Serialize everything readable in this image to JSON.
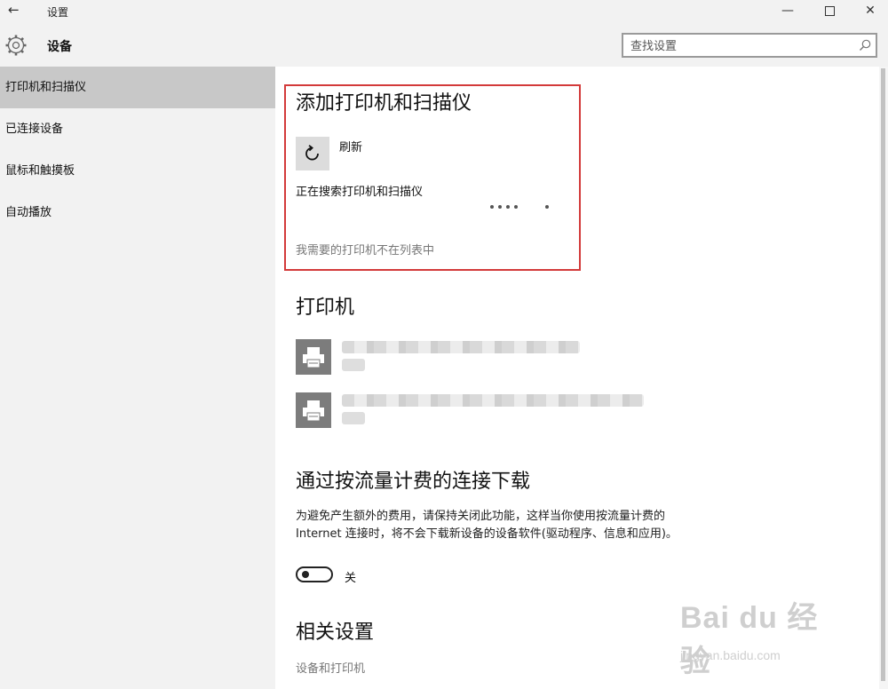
{
  "window": {
    "title": "设置",
    "back_glyph": "←",
    "minimize_glyph": "—",
    "close_glyph": "✕"
  },
  "header": {
    "title": "设备",
    "search_placeholder": "查找设置"
  },
  "sidebar": {
    "items": [
      {
        "label": "打印机和扫描仪",
        "active": true
      },
      {
        "label": "已连接设备",
        "active": false
      },
      {
        "label": "鼠标和触摸板",
        "active": false
      },
      {
        "label": "自动播放",
        "active": false
      }
    ]
  },
  "add_section": {
    "title": "添加打印机和扫描仪",
    "refresh_label": "刷新",
    "searching_text": "正在搜索打印机和扫描仪",
    "not_listed_link": "我需要的打印机不在列表中"
  },
  "printers": {
    "title": "打印机",
    "items": [
      {
        "icon": "printer-icon",
        "name_blurred": true
      },
      {
        "icon": "printer-icon",
        "name_blurred": true
      }
    ]
  },
  "metered": {
    "title": "通过按流量计费的连接下载",
    "description": "为避免产生额外的费用，请保持关闭此功能，这样当你使用按流量计费的 Internet 连接时，将不会下载新设备的设备软件(驱动程序、信息和应用)。",
    "toggle_state": "关"
  },
  "related": {
    "title": "相关设置",
    "link": "设备和打印机"
  },
  "watermark": {
    "main": "Bai du 经验",
    "sub": "jingyan.baidu.com"
  },
  "colors": {
    "highlight_border": "#d33a3a",
    "sidebar_bg": "#f2f2f2",
    "active_item_bg": "#c8c8c8",
    "printer_tile": "#7c7c7c"
  }
}
